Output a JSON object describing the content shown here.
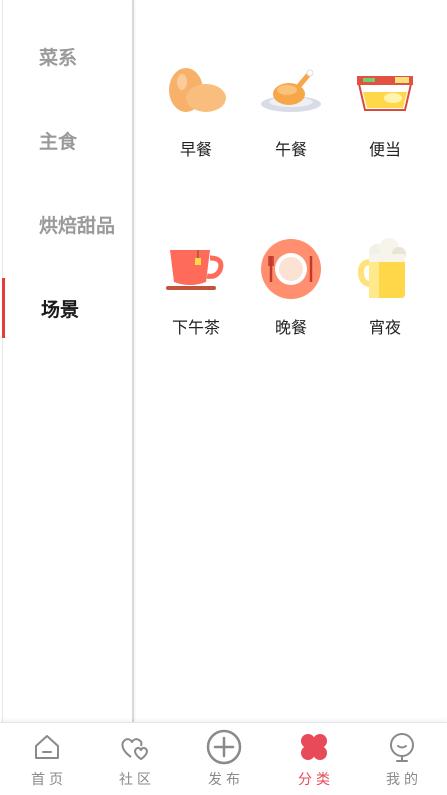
{
  "sidebar": {
    "items": [
      {
        "label": "菜系",
        "active": false
      },
      {
        "label": "主食",
        "active": false
      },
      {
        "label": "烘焙甜品",
        "active": false
      },
      {
        "label": "场景",
        "active": true
      }
    ]
  },
  "categories": [
    {
      "label": "早餐",
      "icon": "eggs-icon"
    },
    {
      "label": "午餐",
      "icon": "roast-chicken-icon"
    },
    {
      "label": "便当",
      "icon": "bento-box-icon"
    },
    {
      "label": "下午茶",
      "icon": "teacup-icon"
    },
    {
      "label": "晚餐",
      "icon": "dinner-plate-icon"
    },
    {
      "label": "宵夜",
      "icon": "beer-mug-icon"
    }
  ],
  "tabbar": {
    "tabs": [
      {
        "label": "首页",
        "icon": "home-icon",
        "active": false
      },
      {
        "label": "社区",
        "icon": "community-hearts-icon",
        "active": false
      },
      {
        "label": "发布",
        "icon": "plus-circle-icon",
        "active": false
      },
      {
        "label": "分类",
        "icon": "clover-icon",
        "active": true
      },
      {
        "label": "我的",
        "icon": "profile-face-icon",
        "active": false
      }
    ]
  },
  "colors": {
    "accent": "#e84a5a",
    "active_indicator": "#e83a3a",
    "inactive_text": "#9a9a9a"
  }
}
